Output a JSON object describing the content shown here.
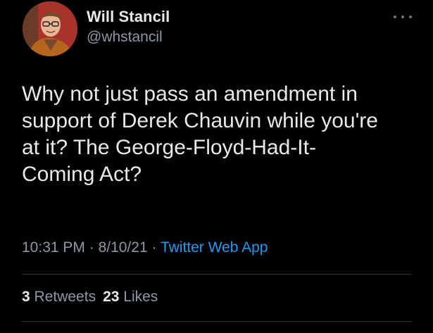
{
  "author": {
    "name": "Will Stancil",
    "handle": "@whstancil"
  },
  "icons": {
    "more": "more-horizontal-icon",
    "avatar": "profile-photo"
  },
  "tweet": {
    "lines": [
      "Why not just pass an amendment in",
      "support of Derek Chauvin while you're",
      "at it? The George-Floyd-Had-It-",
      "Coming Act?"
    ]
  },
  "meta": {
    "time": "10:31 PM",
    "sep1": " · ",
    "date": "8/10/21",
    "sep2": " · ",
    "source": "Twitter Web App"
  },
  "stats": {
    "retweets_count": "3",
    "retweets_label": "Retweets",
    "likes_count": "23",
    "likes_label": "Likes"
  },
  "colors": {
    "background": "#000000",
    "text": "#e7e9ea",
    "secondary": "#8b98a5",
    "link": "#1d9bf0",
    "divider": "#2f3336"
  }
}
